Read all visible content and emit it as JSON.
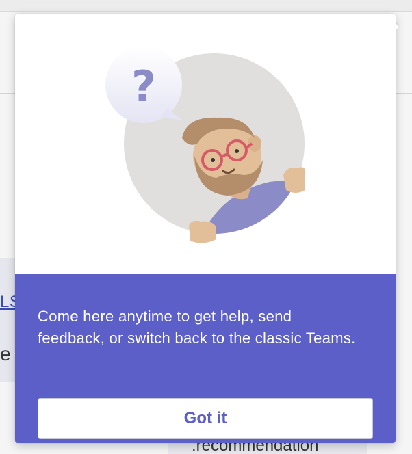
{
  "background": {
    "link_fragment": "LS",
    "text_fragment": "e",
    "code_fragment": ".recommendation"
  },
  "callout": {
    "message": "Come here anytime to get help, send feedback, or switch back to the classic Teams.",
    "button_label": "Got it",
    "illustration": {
      "speech_bubble_glyph": "?",
      "icons": [
        "question-mark-speech-bubble-icon",
        "bearded-person-with-glasses-illustration"
      ]
    },
    "colors": {
      "accent": "#5b5fc7",
      "card_background": "#ffffff",
      "button_text": "#5b5fc7"
    }
  }
}
